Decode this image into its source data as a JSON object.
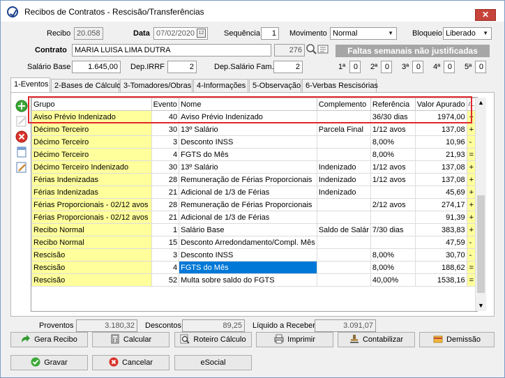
{
  "window": {
    "title": "Recibos de Contratos - Rescisão/Transferências",
    "close_label": "✕"
  },
  "header": {
    "recibo_label": "Recibo",
    "recibo_value": "20.058",
    "data_label": "Data",
    "data_value": "07/02/2020",
    "sequencia_label": "Sequência",
    "sequencia_value": "1",
    "movimento_label": "Movimento",
    "movimento_value": "Normal",
    "bloqueio_label": "Bloqueio",
    "bloqueio_value": "Liberado",
    "contrato_label": "Contrato",
    "contrato_value": "MARIA LUISA LIMA DUTRA",
    "contrato_code": "276",
    "alert": "Faltas semanais não justificadas",
    "salario_label": "Salário Base",
    "salario_value": "1.645,00",
    "irrf_label": "Dep.IRRF",
    "irrf_value": "2",
    "salfam_label": "Dep.Salário Fam.",
    "salfam_value": "2",
    "weeks": [
      {
        "label": "1ª",
        "value": "0"
      },
      {
        "label": "2ª",
        "value": "0"
      },
      {
        "label": "3ª",
        "value": "0"
      },
      {
        "label": "4ª",
        "value": "0"
      },
      {
        "label": "5ª",
        "value": "0"
      }
    ]
  },
  "tabs": [
    {
      "label": "1-Eventos"
    },
    {
      "label": "2-Bases de Cálculo"
    },
    {
      "label": "3-Tomadores/Obras"
    },
    {
      "label": "4-Informações"
    },
    {
      "label": "5-Observação"
    },
    {
      "label": "6-Verbas Rescisórias"
    }
  ],
  "grid": {
    "columns": [
      "Grupo",
      "Evento",
      "Nome",
      "Complemento",
      "Referência",
      "Valor Apurado",
      "/..."
    ],
    "rows": [
      [
        "Aviso Prévio Indenizado",
        "40",
        "Aviso Prévio Indenizado",
        "",
        "36/30 dias",
        "1974,00",
        "+"
      ],
      [
        "Décimo Terceiro",
        "30",
        "13º Salário",
        "Parcela Final",
        "1/12 avos",
        "137,08",
        "+"
      ],
      [
        "Décimo Terceiro",
        "3",
        "Desconto INSS",
        "",
        "8,00%",
        "10,96",
        "-"
      ],
      [
        "Décimo Terceiro",
        "4",
        "FGTS do Mês",
        "",
        "8,00%",
        "21,93",
        "="
      ],
      [
        "Décimo Terceiro Indenizado",
        "30",
        "13º Salário",
        "Indenizado",
        "1/12 avos",
        "137,08",
        "+"
      ],
      [
        "Férias Indenizadas",
        "28",
        "Remuneração de Férias Proporcionais",
        "Indenizado",
        "1/12 avos",
        "137,08",
        "+"
      ],
      [
        "Férias Indenizadas",
        "21",
        "Adicional de 1/3 de Férias",
        "Indenizado",
        "",
        "45,69",
        "+"
      ],
      [
        "Férias Proporcionais - 02/12 avos",
        "28",
        "Remuneração de Férias Proporcionais",
        "",
        "2/12 avos",
        "274,17",
        "+"
      ],
      [
        "Férias Proporcionais - 02/12 avos",
        "21",
        "Adicional de 1/3 de Férias",
        "",
        "",
        "91,39",
        "+"
      ],
      [
        "Recibo Normal",
        "1",
        "Salário Base",
        "Saldo de Salár",
        "7/30 dias",
        "383,83",
        "+"
      ],
      [
        "Recibo Normal",
        "15",
        "Desconto Arredondamento/Compl. Mês",
        "",
        "",
        "47,59",
        "-"
      ],
      [
        "Rescisão",
        "3",
        "Desconto INSS",
        "",
        "8,00%",
        "30,70",
        "-"
      ],
      [
        "Rescisão",
        "4",
        "FGTS do Mês",
        "",
        "8,00%",
        "188,62",
        "="
      ],
      [
        "Rescisão",
        "52",
        "Multa sobre saldo do FGTS",
        "",
        "40,00%",
        "1538,16",
        "="
      ]
    ]
  },
  "totals": {
    "proventos_label": "Proventos",
    "proventos_value": "3.180,32",
    "descontos_label": "Descontos",
    "descontos_value": "89,25",
    "liquido_label": "Líquido a Receber",
    "liquido_value": "3.091,07"
  },
  "buttons": {
    "gera_recibo": "Gera Recibo",
    "calcular": "Calcular",
    "roteiro": "Roteiro Cálculo",
    "imprimir": "Imprimir",
    "contabilizar": "Contabilizar",
    "demissao": "Demissão",
    "gravar": "Gravar",
    "cancelar": "Cancelar",
    "esocial": "eSocial"
  },
  "colors": {
    "group_bg": "#ffff9b",
    "selected_cell": "#0078d7",
    "highlight_border": "#e0262c",
    "alert_bg": "#a6a6a6"
  }
}
